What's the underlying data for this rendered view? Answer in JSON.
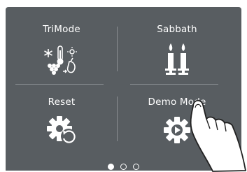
{
  "menu": {
    "tiles": [
      {
        "label": "TriMode",
        "icon": "trimode-icon"
      },
      {
        "label": "Sabbath",
        "icon": "candles-icon"
      },
      {
        "label": "Reset",
        "icon": "gear-reset-icon"
      },
      {
        "label": "Demo Mode",
        "icon": "gear-play-icon"
      }
    ]
  },
  "pager": {
    "pages": 3,
    "current": 1
  },
  "colors": {
    "background": "#585d61",
    "foreground": "#ffffff",
    "divider": "#8a8e92"
  }
}
